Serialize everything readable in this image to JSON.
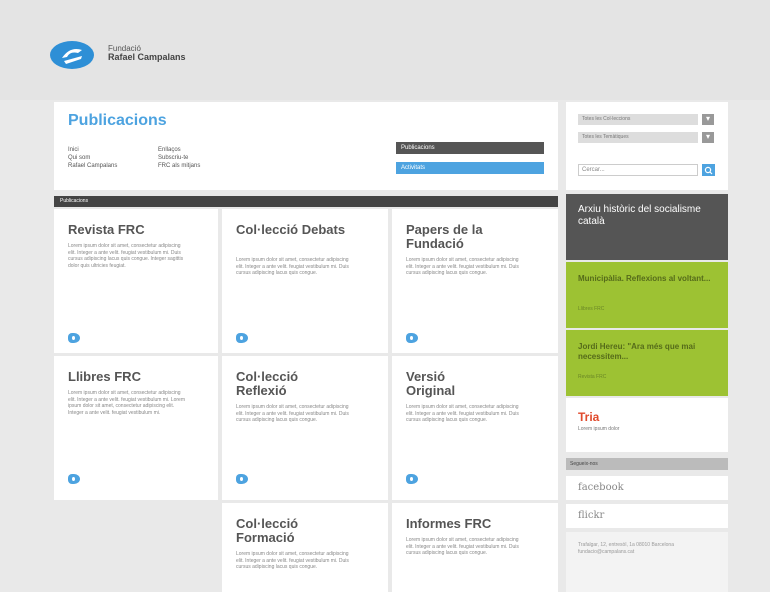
{
  "header": {
    "brand_line1": "Fundació",
    "brand_line2": "Rafael Campalans"
  },
  "main": {
    "title": "Publicacions",
    "nav_left": [
      "Inici",
      "Qui som",
      "Rafael Campalans"
    ],
    "nav_mid": [
      "Enllaços",
      "Subscriu-te",
      "FRC als mitjans"
    ],
    "pill_publicacions": "Publicacions",
    "pill_activitats": "Activitats"
  },
  "right_panel": {
    "select1": "Totes les Col·leccions",
    "select2": "Totes les Temàtiques",
    "search_placeholder": "Cercar..."
  },
  "section_bar": "Publicacions",
  "cards": {
    "revista": {
      "title": "Revista FRC",
      "body": "Lorem ipsum dolor sit amet, consectetur adipiscing elit. Integer a ante velit. feugiat vestibulum mi. Duis cursus adipiscing lacus quis congue. Integer sagittis dolor quis ultricies feugiat."
    },
    "debats": {
      "title": "Col·lecció Debats",
      "body": "Lorem ipsum dolor sit amet, consectetur adipiscing elit. Integer a ante velit. feugiat vestibulum mi. Duis cursus adipiscing lacus quis congue."
    },
    "papers": {
      "title": "Papers de la Fundació",
      "body": "Lorem ipsum dolor sit amet, consectetur adipiscing elit. Integer a ante velit. feugiat vestibulum mi. Duis cursus adipiscing lacus quis congue."
    },
    "llibres": {
      "title": "Llibres FRC",
      "body": "Lorem ipsum dolor sit amet, consectetur adipiscing elit. Integer a ante velit. feugiat vestibulum mi. Lorem ipsum dolor sit amet, consectetur adipiscing elit. Integer a ante velit. feugiat vestibulum mi."
    },
    "reflexio": {
      "title": "Col·lecció Reflexió",
      "body": "Lorem ipsum dolor sit amet, consectetur adipiscing elit. Integer a ante velit. feugiat vestibulum mi. Duis cursus adipiscing lacus quis congue."
    },
    "versio": {
      "title": "Versió Original",
      "body": "Lorem ipsum dolor sit amet, consectetur adipiscing elit. Integer a ante velit. feugiat vestibulum mi. Duis cursus adipiscing lacus quis congue."
    },
    "formacio": {
      "title": "Col·lecció Formació",
      "body": "Lorem ipsum dolor sit amet, consectetur adipiscing elit. Integer a ante velit. feugiat vestibulum mi. Duis cursus adipiscing lacus quis congue."
    },
    "informes": {
      "title": "Informes FRC",
      "body": "Lorem ipsum dolor sit amet, consectetur adipiscing elit. Integer a ante velit. feugiat vestibulum mi. Duis cursus adipiscing lacus quis congue."
    }
  },
  "sidebar": {
    "arxiu": "Arxiu històric del socialisme català",
    "muni_title": "Municipàlia. Reflexions al voltant...",
    "muni_sub": "Llibres FRC",
    "jordi_title": "Jordi Hereu: \"Ara més que mai necessitem...",
    "jordi_sub": "Revista FRC",
    "tria_title": "Tria",
    "tria_sub": "Lorem ipsum dolor",
    "follow": "Segueix-nos",
    "facebook": "facebook",
    "flickr": "flickr",
    "contact": "Trafalgar, 12, entresòl, 1a 08010 Barcelona fundacio@campalans.cat"
  },
  "colors": {
    "accent": "#4da3e0",
    "green": "#9dc233",
    "dark": "#555555",
    "red": "#e04a2c"
  }
}
